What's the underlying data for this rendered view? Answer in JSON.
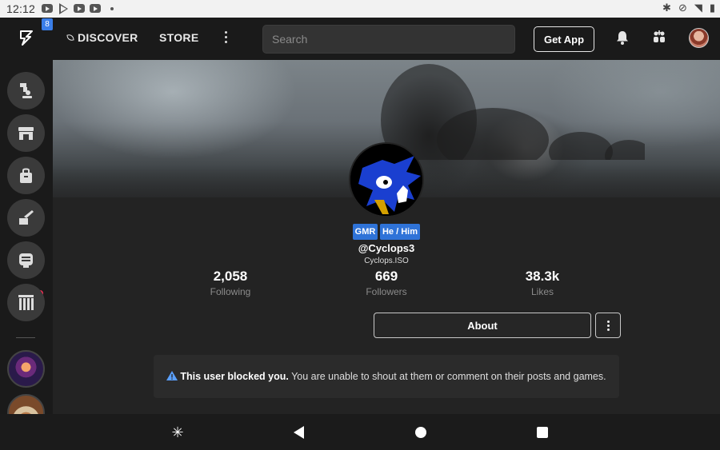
{
  "status_bar": {
    "time": "12:12",
    "notification_icons": [
      "youtube-icon",
      "play-store-icon",
      "youtube-icon",
      "youtube-icon"
    ],
    "system_icons": [
      "bluetooth-icon",
      "dnd-icon",
      "wifi-icon",
      "battery-icon"
    ]
  },
  "top_bar": {
    "notification_badge": "8",
    "nav": [
      {
        "label": "DISCOVER",
        "icon": "leaf-icon"
      },
      {
        "label": "STORE"
      }
    ],
    "search": {
      "placeholder": "Search",
      "value": ""
    },
    "get_app_label": "Get App"
  },
  "sidebar": {
    "items": [
      {
        "icon": "trophy-icon"
      },
      {
        "icon": "store-icon"
      },
      {
        "icon": "bag-icon"
      },
      {
        "icon": "create-icon",
        "has_notification": true
      },
      {
        "icon": "chat-icon"
      },
      {
        "icon": "library-icon"
      }
    ],
    "games": [
      "game-thumbnail-1",
      "game-thumbnail-2"
    ]
  },
  "profile": {
    "tags": [
      "GMR",
      "He / Him"
    ],
    "username": "@Cyclops3",
    "display_name": "Cyclops.ISO",
    "stats": [
      {
        "value": "2,058",
        "label": "Following"
      },
      {
        "value": "669",
        "label": "Followers"
      },
      {
        "value": "38.3k",
        "label": "Likes"
      }
    ],
    "about_label": "About",
    "blocked_notice": {
      "bold": "This user blocked you.",
      "text": "You are unable to shout at them or comment on their posts and games."
    }
  },
  "colors": {
    "accent": "#2f73d8",
    "notification": "#ff2c55",
    "background": "#232323"
  }
}
